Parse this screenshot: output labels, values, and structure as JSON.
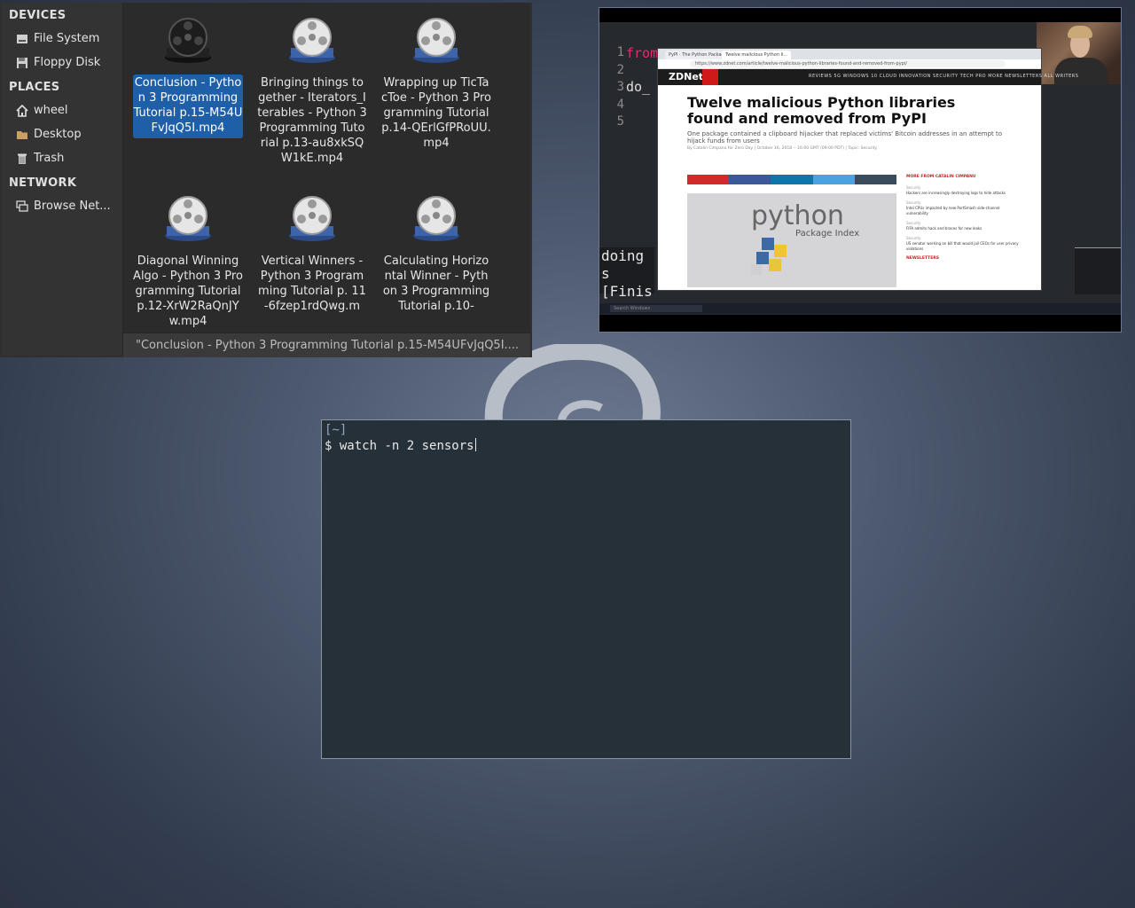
{
  "file_manager": {
    "sidebar": {
      "sections": [
        {
          "title": "DEVICES",
          "items": [
            {
              "label": "File System",
              "icon": "drive-icon"
            },
            {
              "label": "Floppy Disk",
              "icon": "floppy-icon"
            }
          ]
        },
        {
          "title": "PLACES",
          "items": [
            {
              "label": "wheel",
              "icon": "home-icon"
            },
            {
              "label": "Desktop",
              "icon": "folder-icon"
            },
            {
              "label": "Trash",
              "icon": "trash-icon"
            }
          ]
        },
        {
          "title": "NETWORK",
          "items": [
            {
              "label": "Browse Net...",
              "icon": "network-icon"
            }
          ]
        }
      ]
    },
    "files": [
      {
        "name": "Conclusion - Python 3 Programming Tutorial p.15-M54UFvJqQ5I.mp4",
        "selected": true
      },
      {
        "name": "Bringing things together - Iterators_Iterables - Python 3 Programming Tutorial p.13-au8xkSQW1kE.mp4",
        "selected": false
      },
      {
        "name": "Wrapping up TicTacToe - Python 3 Programming Tutorial p.14-QErlGfPRoUU.mp4",
        "selected": false
      },
      {
        "name": "Diagonal Winning Algo - Python 3 Programming Tutorial p.12-XrW2RaQnJYw.mp4",
        "selected": false
      },
      {
        "name": "Vertical Winners - Python 3 Programming Tutorial p. 11-6fzep1rdQwg.m",
        "selected": false
      },
      {
        "name": "Calculating Horizontal Winner - Python 3 Programming Tutorial p.10-",
        "selected": false
      }
    ],
    "status": "\"Conclusion - Python 3 Programming Tutorial p.15-M54UFvJqQ5I...."
  },
  "preview": {
    "gutter": [
      "1",
      "2",
      "3",
      "4",
      "5"
    ],
    "code": [
      "from",
      "",
      "do_"
    ],
    "terminal": [
      "doing s",
      "[Finis"
    ],
    "browser": {
      "tabs": [
        "PyPI · The Python Package Index",
        "Twelve malicious Python li..."
      ],
      "url": "https://www.zdnet.com/article/twelve-malicious-python-libraries-found-and-removed-from-pypi/",
      "site_logo": "ZDNet",
      "menu": "REVIEWS   5G   WINDOWS 10   CLOUD   INNOVATION   SECURITY   TECH PRO   MORE   NEWSLETTERS   ALL WRITERS",
      "headline": "Twelve malicious Python libraries found and removed from PyPI",
      "subhead": "One package contained a clipboard hijacker that replaced victims' Bitcoin addresses in an attempt to hijack funds from users",
      "byline": "By Catalin Cimpanu for Zero Day | October 16, 2018 -- 16:00 GMT (09:00 PDT) | Topic: Security",
      "image_word": "python",
      "image_caption": "Package Index",
      "sidebar_heading": "MORE FROM CATALIN CIMPANU",
      "sidebar_items": [
        {
          "kicker": "Security",
          "text": "Hackers are increasingly destroying logs to hide attacks"
        },
        {
          "kicker": "Security",
          "text": "Intel CPUs impacted by new PortSmash side-channel vulnerability"
        },
        {
          "kicker": "Security",
          "text": "FIFA admits hack and braces for new leaks"
        },
        {
          "kicker": "Security",
          "text": "US senator working on bill that would jail CEOs for user privacy violations"
        }
      ],
      "newsletters": "NEWSLETTERS"
    },
    "taskbar_search": "Search Windows"
  },
  "terminal": {
    "path": "[~]",
    "prompt": "$",
    "command": "watch -n 2 sensors"
  },
  "colors": {
    "selection": "#1f5fa8",
    "terminal_bg": "#263038",
    "desktop_bg": "#4e5a70"
  }
}
